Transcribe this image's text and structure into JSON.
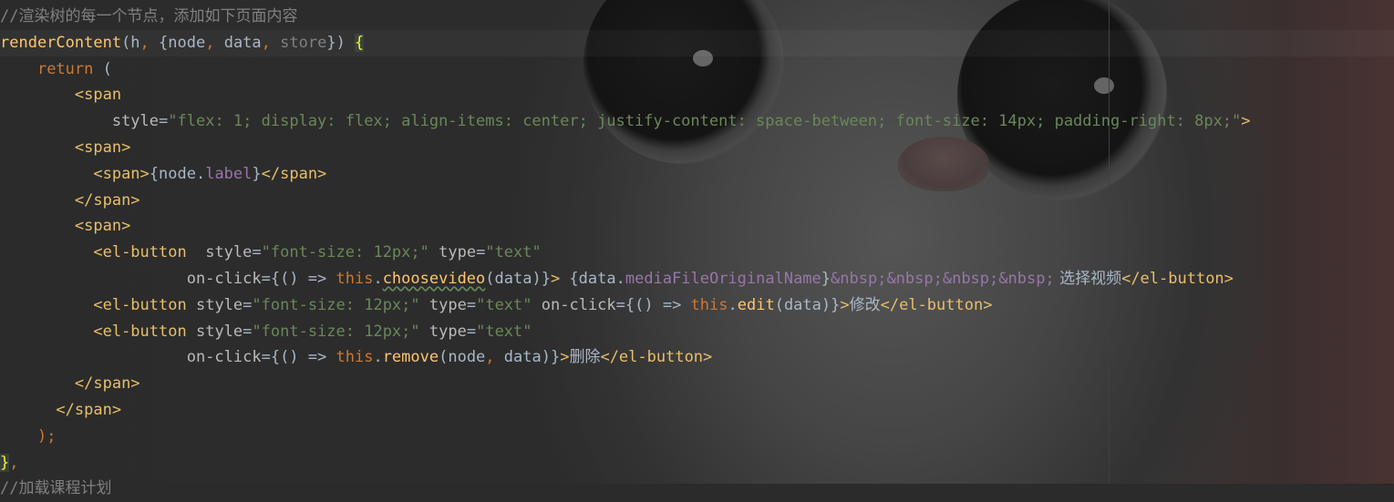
{
  "editor": {
    "lines": [
      {
        "id": "l0",
        "tokens": [
          {
            "t": "//渲染树的每一个节点，添加如下页面内容",
            "c": "c-comment"
          }
        ]
      },
      {
        "id": "l1",
        "hl": true,
        "tokens": [
          {
            "t": "renderContent",
            "c": "c-fn"
          },
          {
            "t": "(h",
            "c": "c-plain"
          },
          {
            "t": ", ",
            "c": "c-kw"
          },
          {
            "t": "{node",
            "c": "c-plain"
          },
          {
            "t": ", ",
            "c": "c-kw"
          },
          {
            "t": "data",
            "c": "c-plain"
          },
          {
            "t": ", ",
            "c": "c-kw"
          },
          {
            "t": "store",
            "c": "c-grey"
          },
          {
            "t": "}) ",
            "c": "c-plain"
          },
          {
            "t": "{",
            "c": "c-brace"
          }
        ]
      },
      {
        "id": "l2",
        "tokens": [
          {
            "t": "    ",
            "c": "c-plain"
          },
          {
            "t": "return",
            "c": "c-kw"
          },
          {
            "t": " (",
            "c": "c-plain"
          }
        ]
      },
      {
        "id": "l3",
        "tokens": [
          {
            "t": "        ",
            "c": "c-plain"
          },
          {
            "t": "<span",
            "c": "c-tag"
          }
        ]
      },
      {
        "id": "l4",
        "tokens": [
          {
            "t": "            ",
            "c": "c-plain"
          },
          {
            "t": "style",
            "c": "c-attr"
          },
          {
            "t": "=",
            "c": "c-plain"
          },
          {
            "t": "\"flex: 1; display: flex; align-items: center; justify-content: space-between; font-size: 14px; padding-right: 8px;\"",
            "c": "c-str"
          },
          {
            "t": ">",
            "c": "c-tag"
          }
        ]
      },
      {
        "id": "l5",
        "tokens": [
          {
            "t": "        ",
            "c": "c-plain"
          },
          {
            "t": "<span>",
            "c": "c-tag"
          }
        ]
      },
      {
        "id": "l6",
        "tokens": [
          {
            "t": "          ",
            "c": "c-plain"
          },
          {
            "t": "<span>",
            "c": "c-tag"
          },
          {
            "t": "{node.",
            "c": "c-plain"
          },
          {
            "t": "label",
            "c": "c-field"
          },
          {
            "t": "}",
            "c": "c-plain"
          },
          {
            "t": "</span>",
            "c": "c-tag"
          }
        ]
      },
      {
        "id": "l7",
        "tokens": [
          {
            "t": "        ",
            "c": "c-plain"
          },
          {
            "t": "</span>",
            "c": "c-tag"
          }
        ]
      },
      {
        "id": "l8",
        "tokens": [
          {
            "t": "        ",
            "c": "c-plain"
          },
          {
            "t": "<span>",
            "c": "c-tag"
          }
        ]
      },
      {
        "id": "l9",
        "tokens": [
          {
            "t": "          ",
            "c": "c-plain"
          },
          {
            "t": "<el-button",
            "c": "c-tag"
          },
          {
            "t": "  ",
            "c": "c-plain"
          },
          {
            "t": "style",
            "c": "c-attr"
          },
          {
            "t": "=",
            "c": "c-plain"
          },
          {
            "t": "\"font-size: 12px;\"",
            "c": "c-str"
          },
          {
            "t": " ",
            "c": "c-plain"
          },
          {
            "t": "type",
            "c": "c-attr"
          },
          {
            "t": "=",
            "c": "c-plain"
          },
          {
            "t": "\"text\"",
            "c": "c-str"
          }
        ]
      },
      {
        "id": "l10",
        "tokens": [
          {
            "t": "                    ",
            "c": "c-plain"
          },
          {
            "t": "on-click",
            "c": "c-attr"
          },
          {
            "t": "={() => ",
            "c": "c-plain"
          },
          {
            "t": "this",
            "c": "c-kw"
          },
          {
            "t": ".",
            "c": "c-plain"
          },
          {
            "t": "choosevideo",
            "c": "c-fn squig"
          },
          {
            "t": "(data)}",
            "c": "c-plain"
          },
          {
            "t": "> ",
            "c": "c-tag"
          },
          {
            "t": "{data.",
            "c": "c-plain"
          },
          {
            "t": "mediaFileOriginalName",
            "c": "c-field"
          },
          {
            "t": "}",
            "c": "c-plain"
          },
          {
            "t": "&nbsp;&nbsp;&nbsp;&nbsp;",
            "c": "c-entity"
          },
          {
            "t": " 选择视频",
            "c": "c-plain cjk"
          },
          {
            "t": "</el-button>",
            "c": "c-tag"
          }
        ]
      },
      {
        "id": "l11",
        "tokens": [
          {
            "t": "          ",
            "c": "c-plain"
          },
          {
            "t": "<el-button",
            "c": "c-tag"
          },
          {
            "t": " ",
            "c": "c-plain"
          },
          {
            "t": "style",
            "c": "c-attr"
          },
          {
            "t": "=",
            "c": "c-plain"
          },
          {
            "t": "\"font-size: 12px;\"",
            "c": "c-str"
          },
          {
            "t": " ",
            "c": "c-plain"
          },
          {
            "t": "type",
            "c": "c-attr"
          },
          {
            "t": "=",
            "c": "c-plain"
          },
          {
            "t": "\"text\"",
            "c": "c-str"
          },
          {
            "t": " ",
            "c": "c-plain"
          },
          {
            "t": "on-click",
            "c": "c-attr"
          },
          {
            "t": "={() => ",
            "c": "c-plain"
          },
          {
            "t": "this",
            "c": "c-kw"
          },
          {
            "t": ".",
            "c": "c-plain"
          },
          {
            "t": "edit",
            "c": "c-fn"
          },
          {
            "t": "(data)}",
            "c": "c-plain"
          },
          {
            "t": ">",
            "c": "c-tag"
          },
          {
            "t": "修改",
            "c": "c-plain cjk"
          },
          {
            "t": "</el-button>",
            "c": "c-tag"
          }
        ]
      },
      {
        "id": "l12",
        "tokens": [
          {
            "t": "          ",
            "c": "c-plain"
          },
          {
            "t": "<el-button",
            "c": "c-tag"
          },
          {
            "t": " ",
            "c": "c-plain"
          },
          {
            "t": "style",
            "c": "c-attr"
          },
          {
            "t": "=",
            "c": "c-plain"
          },
          {
            "t": "\"font-size: 12px;\"",
            "c": "c-str"
          },
          {
            "t": " ",
            "c": "c-plain"
          },
          {
            "t": "type",
            "c": "c-attr"
          },
          {
            "t": "=",
            "c": "c-plain"
          },
          {
            "t": "\"text\"",
            "c": "c-str"
          }
        ]
      },
      {
        "id": "l13",
        "tokens": [
          {
            "t": "                    ",
            "c": "c-plain"
          },
          {
            "t": "on-click",
            "c": "c-attr"
          },
          {
            "t": "={() => ",
            "c": "c-plain"
          },
          {
            "t": "this",
            "c": "c-kw"
          },
          {
            "t": ".",
            "c": "c-plain"
          },
          {
            "t": "remove",
            "c": "c-fn"
          },
          {
            "t": "(node",
            "c": "c-plain"
          },
          {
            "t": ", ",
            "c": "c-kw"
          },
          {
            "t": "data)}",
            "c": "c-plain"
          },
          {
            "t": ">",
            "c": "c-tag"
          },
          {
            "t": "删除",
            "c": "c-plain cjk"
          },
          {
            "t": "</el-button>",
            "c": "c-tag"
          }
        ]
      },
      {
        "id": "l14",
        "tokens": [
          {
            "t": "        ",
            "c": "c-plain"
          },
          {
            "t": "</span>",
            "c": "c-tag"
          }
        ]
      },
      {
        "id": "l15",
        "tokens": [
          {
            "t": "      ",
            "c": "c-plain"
          },
          {
            "t": "</span>",
            "c": "c-tag"
          }
        ]
      },
      {
        "id": "l16",
        "tokens": [
          {
            "t": "    ",
            "c": "c-plain"
          },
          {
            "t": ");",
            "c": "c-kw"
          }
        ]
      },
      {
        "id": "l17",
        "tokens": [
          {
            "t": "}",
            "c": "c-brace"
          },
          {
            "t": ",",
            "c": "c-kw"
          }
        ]
      },
      {
        "id": "l18",
        "tokens": [
          {
            "t": "//加载课程计划",
            "c": "c-comment"
          }
        ]
      }
    ]
  }
}
